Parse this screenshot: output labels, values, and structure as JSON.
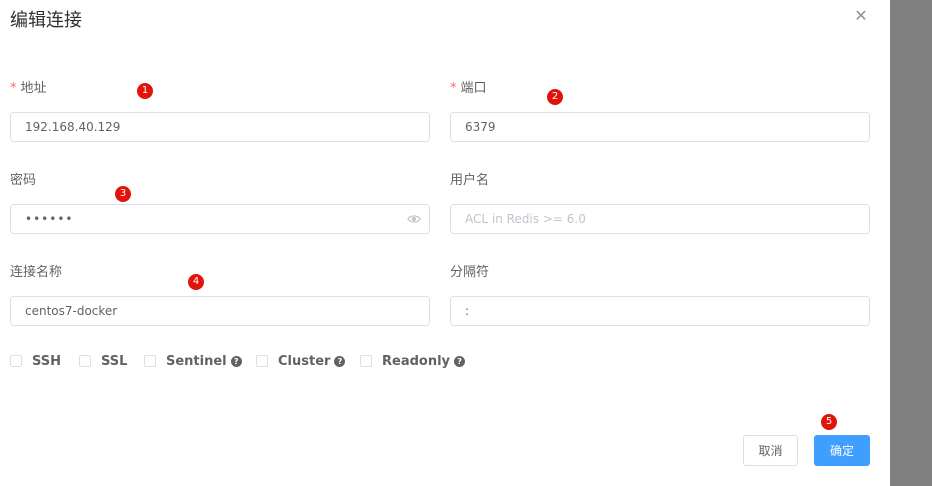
{
  "dialog": {
    "title": "编辑连接",
    "close_icon": "close-icon"
  },
  "form": {
    "host": {
      "label": "地址",
      "required_mark": "*",
      "value": "192.168.40.129"
    },
    "port": {
      "label": "端口",
      "required_mark": "*",
      "value": "6379"
    },
    "password": {
      "label": "密码",
      "value": "••••••",
      "icon": "eye-icon"
    },
    "username": {
      "label": "用户名",
      "value": "",
      "placeholder": "ACL in Redis >= 6.0"
    },
    "name": {
      "label": "连接名称",
      "value": "centos7-docker"
    },
    "separator": {
      "label": "分隔符",
      "value": ":"
    }
  },
  "options": [
    {
      "label": "SSH",
      "checked": false,
      "help": false
    },
    {
      "label": "SSL",
      "checked": false,
      "help": false
    },
    {
      "label": "Sentinel",
      "checked": false,
      "help": true
    },
    {
      "label": "Cluster",
      "checked": false,
      "help": true
    },
    {
      "label": "Readonly",
      "checked": false,
      "help": true
    }
  ],
  "help_glyph": "?",
  "buttons": {
    "cancel": "取消",
    "ok": "确定"
  },
  "badges": [
    "1",
    "2",
    "3",
    "4",
    "5"
  ],
  "colors": {
    "primary": "#409eff",
    "badge": "#e0140b",
    "required": "#f56c6c",
    "overlay": "#808080"
  }
}
